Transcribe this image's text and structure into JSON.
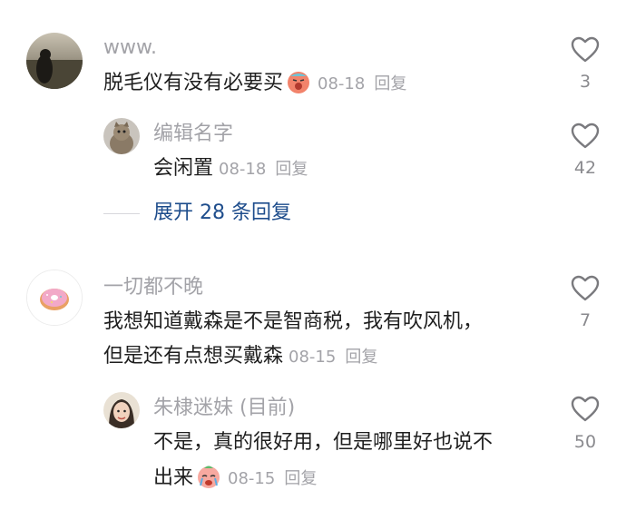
{
  "comments": [
    {
      "username": "www.",
      "text": "脱毛仪有没有必要买",
      "date": "08-18",
      "reply": "回复",
      "likes": "3",
      "emoji": "exhausted-face-emoji"
    },
    {
      "username": "编辑名字",
      "text": "会闲置",
      "date": "08-18",
      "reply": "回复",
      "likes": "42"
    },
    {
      "expand": "展开 28 条回复"
    },
    {
      "username": "一切都不晚",
      "text_line1": "我想知道戴森是不是智商税，我有吹风机，",
      "text_line2": "但是还有点想买戴森",
      "date": "08-15",
      "reply": "回复",
      "likes": "7"
    },
    {
      "username": "朱棣迷妹 (目前)",
      "text_line1": "不是，真的很好用，但是哪里好也说不",
      "text_line2": "出来",
      "date": "08-15",
      "reply": "回复",
      "likes": "50",
      "emoji": "crying-face-emoji"
    }
  ],
  "colors": {
    "text": "#1f1f1f",
    "meta": "#a3a3a8",
    "link": "#1e4d8c",
    "heart": "#7a7a7e"
  }
}
